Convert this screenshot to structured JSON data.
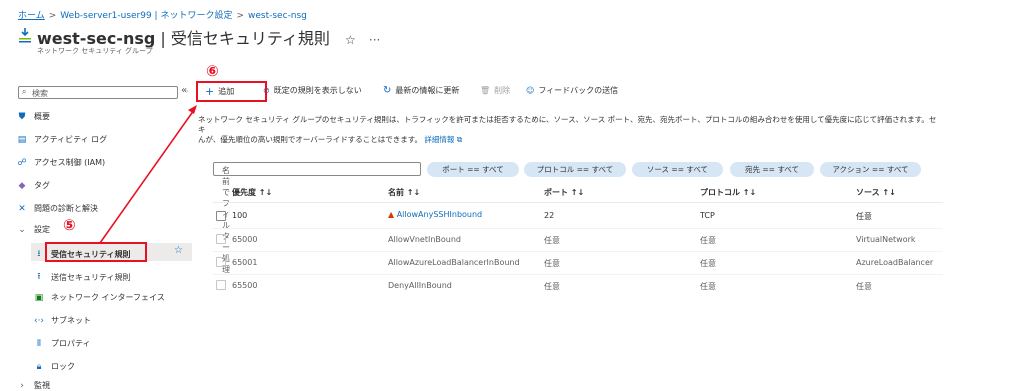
{
  "breadcrumb": {
    "home": "ホーム",
    "server": "Web-server1-user99 | ネットワーク設定",
    "current": "west-sec-nsg",
    "separator": ">"
  },
  "header": {
    "name": "west-sec-nsg",
    "divider": "|",
    "page": "受信セキュリティ規則",
    "star": "☆",
    "more": "···",
    "subtitle": "ネットワーク セキュリティ グループ"
  },
  "sidebar": {
    "search_placeholder": "検索",
    "collapse": "«",
    "items": [
      {
        "label": "概要",
        "icon": "shield-icon"
      },
      {
        "label": "アクティビティ ログ",
        "icon": "log-icon"
      },
      {
        "label": "アクセス制御 (IAM)",
        "icon": "people-icon"
      },
      {
        "label": "タグ",
        "icon": "tag-icon"
      },
      {
        "label": "問題の診断と解決",
        "icon": "wrench-icon"
      },
      {
        "label": "設定",
        "icon": "chevron-down-icon"
      },
      {
        "label": "受信セキュリティ規則",
        "icon": "inbound-icon"
      },
      {
        "label": "送信セキュリティ規則",
        "icon": "outbound-icon"
      },
      {
        "label": "ネットワーク インターフェイス",
        "icon": "nic-icon"
      },
      {
        "label": "サブネット",
        "icon": "subnet-icon"
      },
      {
        "label": "プロパティ",
        "icon": "properties-icon"
      },
      {
        "label": "ロック",
        "icon": "lock-icon"
      },
      {
        "label": "監視",
        "icon": "chevron-right-icon"
      }
    ]
  },
  "toolbar": {
    "add": "追加",
    "hide_default": "既定の規則を表示しない",
    "refresh": "最新の情報に更新",
    "delete": "削除",
    "feedback": "フィードバックの送信"
  },
  "description": {
    "text": "ネットワーク セキュリティ グループのセキュリティ規則は、トラフィックを許可または拒否するために、ソース、ソース ポート、宛先、宛先ポート、プロトコルの組み合わせを使用して優先度に応じて評価されます。セキュリティ規則の優先順位は一意である必要があります。優先順位の低い規則は、優先順位の高い規則でオーバーライドすることはできません。",
    "text_visible": "ネットワーク セキュリティ グループのセキュリティ規則は、トラフィックを許可または拒否するために、ソース、ソース ポート、宛先、宛先ポート、プロトコルの組み合わせを使用して優先度に応じて評価されます。セキ",
    "text_line2": "んが、優先順位の高い規則でオーバーライドすることはできます。",
    "link": "詳細情報"
  },
  "filter": {
    "placeholder": "名前でフィルター処理",
    "pills": [
      "ポート == すべて",
      "プロトコル == すべて",
      "ソース == すべて",
      "宛先 == すべて",
      "アクション == すべて"
    ]
  },
  "table": {
    "headers": [
      "優先度 ↑↓",
      "名前 ↑↓",
      "ポート ↑↓",
      "プロトコル ↑↓",
      "ソース ↑↓"
    ],
    "rows": [
      {
        "priority": "100",
        "name": "AllowAnySSHInbound",
        "port": "22",
        "protocol": "TCP",
        "source": "任意"
      },
      {
        "priority": "65000",
        "name": "AllowVnetInBound",
        "port": "任意",
        "protocol": "任意",
        "source": "VirtualNetwork"
      },
      {
        "priority": "65001",
        "name": "AllowAzureLoadBalancerInBound",
        "port": "任意",
        "protocol": "任意",
        "source": "AzureLoadBalancer"
      },
      {
        "priority": "65500",
        "name": "DenyAllInBound",
        "port": "任意",
        "protocol": "任意",
        "source": "任意"
      }
    ]
  },
  "annotations": {
    "step5": "⑤",
    "step6": "⑥",
    "color": "#e81123"
  }
}
